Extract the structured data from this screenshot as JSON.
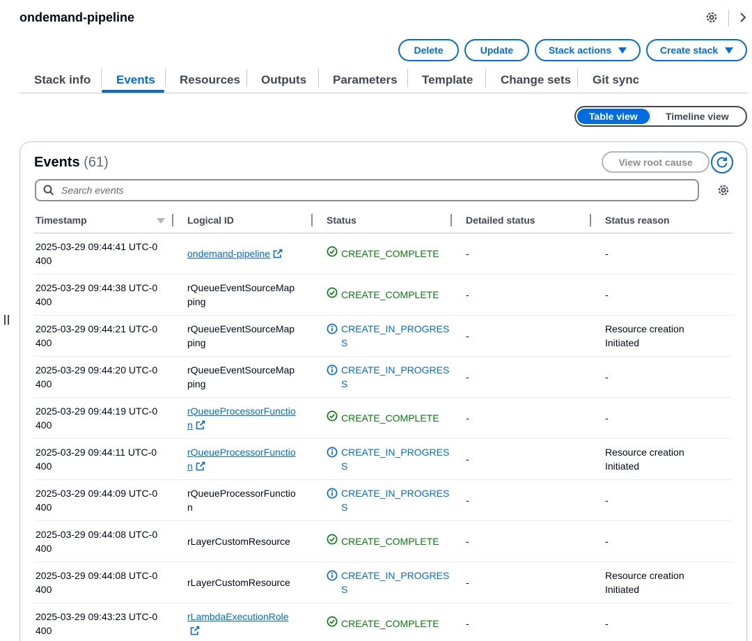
{
  "header": {
    "title": "ondemand-pipeline",
    "buttons": {
      "delete": "Delete",
      "update": "Update",
      "stack_actions": "Stack actions",
      "create_stack": "Create stack"
    }
  },
  "tabs": [
    "Stack info",
    "Events",
    "Resources",
    "Outputs",
    "Parameters",
    "Template",
    "Change sets",
    "Git sync"
  ],
  "active_tab": "Events",
  "view_toggle": {
    "table": "Table view",
    "timeline": "Timeline view",
    "selected": "Table view"
  },
  "events": {
    "title": "Events",
    "count": "(61)",
    "view_root_cause": "View root cause",
    "search_placeholder": "Search events",
    "columns": [
      "Timestamp",
      "Logical ID",
      "Status",
      "Detailed status",
      "Status reason"
    ],
    "rows": [
      {
        "timestamp": "2025-03-29 09:44:41 UTC-0400",
        "logical_id": "ondemand-pipeline",
        "logical_id_link": true,
        "status": "CREATE_COMPLETE",
        "detailed_status": "-",
        "reason": "-"
      },
      {
        "timestamp": "2025-03-29 09:44:38 UTC-0400",
        "logical_id": "rQueueEventSourceMapping",
        "logical_id_link": false,
        "status": "CREATE_COMPLETE",
        "detailed_status": "-",
        "reason": "-"
      },
      {
        "timestamp": "2025-03-29 09:44:21 UTC-0400",
        "logical_id": "rQueueEventSourceMapping",
        "logical_id_link": false,
        "status": "CREATE_IN_PROGRESS",
        "detailed_status": "-",
        "reason": "Resource creation Initiated"
      },
      {
        "timestamp": "2025-03-29 09:44:20 UTC-0400",
        "logical_id": "rQueueEventSourceMapping",
        "logical_id_link": false,
        "status": "CREATE_IN_PROGRESS",
        "detailed_status": "-",
        "reason": "-"
      },
      {
        "timestamp": "2025-03-29 09:44:19 UTC-0400",
        "logical_id": "rQueueProcessorFunction",
        "logical_id_link": true,
        "status": "CREATE_COMPLETE",
        "detailed_status": "-",
        "reason": "-"
      },
      {
        "timestamp": "2025-03-29 09:44:11 UTC-0400",
        "logical_id": "rQueueProcessorFunction",
        "logical_id_link": true,
        "status": "CREATE_IN_PROGRESS",
        "detailed_status": "-",
        "reason": "Resource creation Initiated"
      },
      {
        "timestamp": "2025-03-29 09:44:09 UTC-0400",
        "logical_id": "rQueueProcessorFunction",
        "logical_id_link": false,
        "status": "CREATE_IN_PROGRESS",
        "detailed_status": "-",
        "reason": "-"
      },
      {
        "timestamp": "2025-03-29 09:44:08 UTC-0400",
        "logical_id": "rLayerCustomResource",
        "logical_id_link": false,
        "status": "CREATE_COMPLETE",
        "detailed_status": "-",
        "reason": "-"
      },
      {
        "timestamp": "2025-03-29 09:44:08 UTC-0400",
        "logical_id": "rLayerCustomResource",
        "logical_id_link": false,
        "status": "CREATE_IN_PROGRESS",
        "detailed_status": "-",
        "reason": "Resource creation Initiated"
      },
      {
        "timestamp": "2025-03-29 09:43:23 UTC-0400",
        "logical_id": "rLambdaExecutionRole",
        "logical_id_link": true,
        "status": "CREATE_COMPLETE",
        "detailed_status": "-",
        "reason": "-"
      }
    ]
  },
  "colors": {
    "accent": "#006ce0",
    "success": "#037f0c",
    "text": "#000716",
    "muted": "#424650"
  }
}
